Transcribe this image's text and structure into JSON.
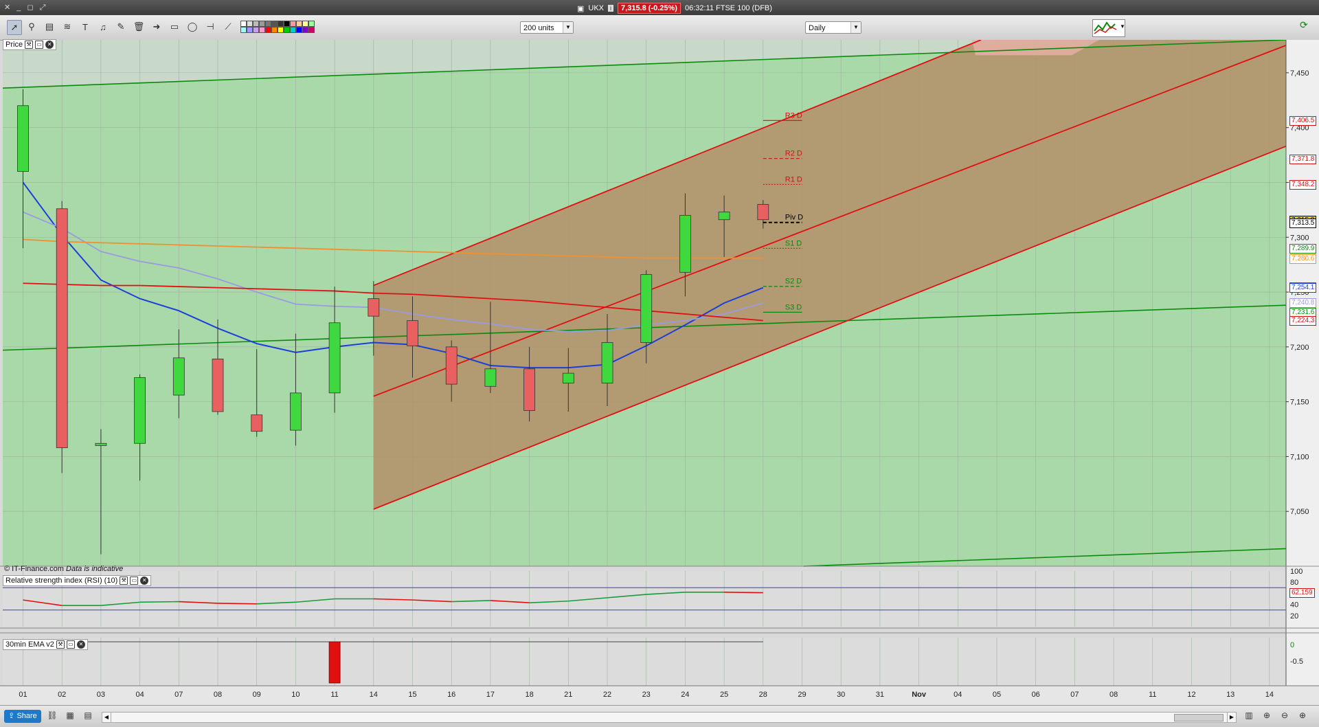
{
  "titlebar": {
    "symbol": "UKX",
    "price_badge": "7,315.8 (-0.25%)",
    "time_and_instrument": "06:32:11 FTSE 100 (DFB)"
  },
  "toolbar": {
    "units_select": "200 units",
    "interval_select": "Daily",
    "color_swatches": [
      "#ffffff",
      "#dddddd",
      "#bbbbbb",
      "#999999",
      "#777777",
      "#555555",
      "#333333",
      "#000000",
      "#ff9999",
      "#ffcc99",
      "#ffff99",
      "#99ff99",
      "#99ffff",
      "#9999ff",
      "#cc99ff",
      "#ff99cc",
      "#ff0000",
      "#ff8800",
      "#ffff00",
      "#00cc00",
      "#00cccc",
      "#0000ff",
      "#8800cc",
      "#cc0066"
    ]
  },
  "panels": {
    "price_label": "Price",
    "rsi_label": "Relative strength index (RSI) (10)",
    "ema_label": "30min EMA v2",
    "copyright": "© IT-Finance.com",
    "indicative": "Data is indicative"
  },
  "colors": {
    "up_candle": "#3fd83f",
    "down_candle": "#e86060",
    "channel_fill": "#b4906a",
    "green_zone": "#a8d8a8",
    "red_line": "#e01010",
    "green_line": "#0a8a0a",
    "blue_line": "#1a3fd8",
    "lavender_line": "#9a9ae0",
    "orange_line": "#f09030"
  },
  "pivots": [
    {
      "label": "R3 D",
      "value": 7406.5,
      "color": "#d01010",
      "style": "solid"
    },
    {
      "label": "R2 D",
      "value": 7371.8,
      "color": "#d01010",
      "style": "dash"
    },
    {
      "label": "R1 D",
      "value": 7348.2,
      "color": "#d01010",
      "style": "dot"
    },
    {
      "label": "Piv D",
      "value": 7313.5,
      "color": "#000000",
      "style": "dash"
    },
    {
      "label": "S1 D",
      "value": 7289.9,
      "color": "#0a8a0a",
      "style": "dot"
    },
    {
      "label": "S2 D",
      "value": 7255.2,
      "color": "#0a8a0a",
      "style": "dash"
    },
    {
      "label": "S3 D",
      "value": 7231.6,
      "color": "#0a8a0a",
      "style": "solid"
    }
  ],
  "yaxis": {
    "ticks": [
      "7,450",
      "7,400",
      "7,350",
      "7,300",
      "7,250",
      "7,200",
      "7,150",
      "7,100",
      "7,050"
    ],
    "tick_values": [
      7450,
      7400,
      7350,
      7300,
      7250,
      7200,
      7150,
      7100,
      7050
    ],
    "badges": [
      {
        "text": "7,406.5",
        "value": 7406.5,
        "bg": "#ffffff",
        "fg": "#d01010"
      },
      {
        "text": "7,371.8",
        "value": 7371.8,
        "bg": "#ffffff",
        "fg": "#d01010"
      },
      {
        "text": "7,348.2",
        "value": 7348.2,
        "bg": "#ffffff",
        "fg": "#d01010"
      },
      {
        "text": "7,315.8",
        "value": 7315.8,
        "bg": "#f0d000",
        "fg": "#000000"
      },
      {
        "text": "7,313.5",
        "value": 7313.5,
        "bg": "#ffffff",
        "fg": "#000000"
      },
      {
        "text": "7,289.9",
        "value": 7289.9,
        "bg": "#ffffff",
        "fg": "#0a8a0a"
      },
      {
        "text": "7,280.6",
        "value": 7280.6,
        "bg": "#ffffff",
        "fg": "#f09030"
      },
      {
        "text": "7,255.2",
        "value": 7255.2,
        "bg": "#ffffff",
        "fg": "#0a8a0a"
      },
      {
        "text": "7,254.1",
        "value": 7254.1,
        "bg": "#ffffff",
        "fg": "#1a3fd8"
      },
      {
        "text": "7,240.8",
        "value": 7240.8,
        "bg": "#ffffff",
        "fg": "#9a9ae0"
      },
      {
        "text": "7,231.6",
        "value": 7231.6,
        "bg": "#ffffff",
        "fg": "#0a8a0a"
      },
      {
        "text": "7,224.3",
        "value": 7224.3,
        "bg": "#ffffff",
        "fg": "#d01010"
      }
    ]
  },
  "rsi": {
    "ticks": [
      "100",
      "80",
      "60",
      "40",
      "20"
    ],
    "tick_values": [
      100,
      80,
      60,
      40,
      20
    ],
    "last_value": "62.159",
    "values": [
      48,
      38,
      38,
      44,
      45,
      42,
      41,
      44,
      50,
      50,
      48,
      45,
      47,
      43,
      46,
      52,
      58,
      62,
      62,
      61
    ]
  },
  "ema_panel": {
    "ticks": [
      "0",
      "-0.5"
    ]
  },
  "xaxis": {
    "labels": [
      "01",
      "02",
      "03",
      "04",
      "07",
      "08",
      "09",
      "10",
      "11",
      "14",
      "15",
      "16",
      "17",
      "18",
      "21",
      "22",
      "23",
      "24",
      "25",
      "28",
      "29",
      "30",
      "31",
      "Nov",
      "04",
      "05",
      "06",
      "07",
      "08",
      "11",
      "12",
      "13",
      "14"
    ]
  },
  "chart_data": {
    "type": "candlestick",
    "instrument": "FTSE 100 (DFB)",
    "interval": "Daily",
    "ylim": [
      7000,
      7480
    ],
    "categories": [
      "01",
      "02",
      "03",
      "04",
      "07",
      "08",
      "09",
      "10",
      "11",
      "14",
      "15",
      "16",
      "17",
      "18",
      "21",
      "22",
      "23",
      "24",
      "25",
      "28"
    ],
    "candles": [
      {
        "o": 7360,
        "h": 7435,
        "l": 7290,
        "c": 7420
      },
      {
        "o": 7326,
        "h": 7333,
        "l": 7085,
        "c": 7108
      },
      {
        "o": 7110,
        "h": 7125,
        "l": 7011,
        "c": 7112
      },
      {
        "o": 7112,
        "h": 7175,
        "l": 7078,
        "c": 7172
      },
      {
        "o": 7156,
        "h": 7216,
        "l": 7135,
        "c": 7190
      },
      {
        "o": 7189,
        "h": 7225,
        "l": 7138,
        "c": 7141
      },
      {
        "o": 7138,
        "h": 7198,
        "l": 7118,
        "c": 7123
      },
      {
        "o": 7124,
        "h": 7212,
        "l": 7110,
        "c": 7158
      },
      {
        "o": 7158,
        "h": 7255,
        "l": 7140,
        "c": 7222
      },
      {
        "o": 7244,
        "h": 7260,
        "l": 7192,
        "c": 7228
      },
      {
        "o": 7224,
        "h": 7246,
        "l": 7172,
        "c": 7201
      },
      {
        "o": 7200,
        "h": 7206,
        "l": 7150,
        "c": 7166
      },
      {
        "o": 7164,
        "h": 7241,
        "l": 7158,
        "c": 7180
      },
      {
        "o": 7180,
        "h": 7200,
        "l": 7132,
        "c": 7142
      },
      {
        "o": 7167,
        "h": 7199,
        "l": 7141,
        "c": 7176
      },
      {
        "o": 7167,
        "h": 7230,
        "l": 7146,
        "c": 7204
      },
      {
        "o": 7204,
        "h": 7270,
        "l": 7185,
        "c": 7266
      },
      {
        "o": 7268,
        "h": 7340,
        "l": 7246,
        "c": 7320
      },
      {
        "o": 7316,
        "h": 7338,
        "l": 7282,
        "c": 7323
      },
      {
        "o": 7330,
        "h": 7334,
        "l": 7308,
        "c": 7316
      }
    ],
    "series": [
      {
        "name": "",
        "color": "#1a3fd8",
        "values": [
          7350,
          7302,
          7261,
          7244,
          7233,
          7217,
          7203,
          7195,
          7200,
          7204,
          7202,
          7194,
          7183,
          7181,
          7181,
          7184,
          7201,
          7220,
          7240,
          7254
        ]
      },
      {
        "name": "",
        "color": "#9a9ae0",
        "values": [
          7323,
          7308,
          7287,
          7278,
          7272,
          7262,
          7250,
          7239,
          7237,
          7236,
          7230,
          7225,
          7221,
          7216,
          7214,
          7215,
          7220,
          7224,
          7230,
          7240
        ]
      },
      {
        "name": "",
        "color": "#f09030",
        "values": [
          7298,
          7296,
          7295,
          7294,
          7293,
          7292,
          7291,
          7290,
          7289,
          7288,
          7287,
          7286,
          7285,
          7284,
          7283,
          7282,
          7281,
          7281,
          7281,
          7281
        ]
      },
      {
        "name": "",
        "color": "#e01010",
        "values": [
          7258,
          7257,
          7256,
          7256,
          7255,
          7254,
          7253,
          7252,
          7251,
          7249,
          7248,
          7246,
          7244,
          7242,
          7239,
          7236,
          7233,
          7230,
          7227,
          7224
        ]
      }
    ]
  }
}
